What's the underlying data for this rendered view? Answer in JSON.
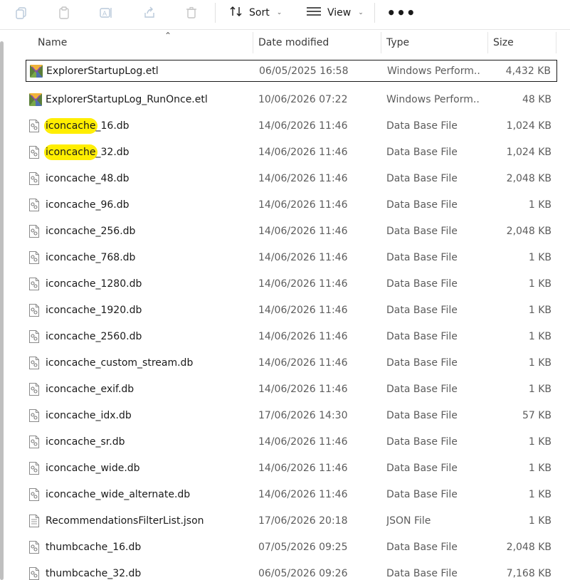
{
  "toolbar": {
    "sort_label": "Sort",
    "view_label": "View",
    "more_label": "•••"
  },
  "columns": {
    "name": "Name",
    "date": "Date modified",
    "type": "Type",
    "size": "Size"
  },
  "colors": {
    "highlight": "#ffee00",
    "text": "#1a1a1a",
    "muted": "#5c5c5c"
  },
  "files": [
    {
      "name": "ExplorerStartupLog.etl",
      "date": "06/05/2025 16:58",
      "type": "Windows Perform...",
      "size": "4,432 KB",
      "icon": "etl-file-icon",
      "selected": true
    },
    {
      "name": "ExplorerStartupLog_RunOnce.etl",
      "date": "10/06/2026 07:22",
      "type": "Windows Perform...",
      "size": "48 KB",
      "icon": "etl-file-icon"
    },
    {
      "name_hl": "iconcache",
      "name_rest": "_16.db",
      "name": "iconcache_16.db",
      "date": "14/06/2026 11:46",
      "type": "Data Base File",
      "size": "1,024 KB",
      "icon": "db-file-icon",
      "highlight": true
    },
    {
      "name_hl": "iconcache",
      "name_rest": "_32.db",
      "name": "iconcache_32.db",
      "date": "14/06/2026 11:46",
      "type": "Data Base File",
      "size": "1,024 KB",
      "icon": "db-file-icon",
      "highlight": true
    },
    {
      "name": "iconcache_48.db",
      "date": "14/06/2026 11:46",
      "type": "Data Base File",
      "size": "2,048 KB",
      "icon": "db-file-icon"
    },
    {
      "name": "iconcache_96.db",
      "date": "14/06/2026 11:46",
      "type": "Data Base File",
      "size": "1 KB",
      "icon": "db-file-icon"
    },
    {
      "name": "iconcache_256.db",
      "date": "14/06/2026 11:46",
      "type": "Data Base File",
      "size": "2,048 KB",
      "icon": "db-file-icon"
    },
    {
      "name": "iconcache_768.db",
      "date": "14/06/2026 11:46",
      "type": "Data Base File",
      "size": "1 KB",
      "icon": "db-file-icon"
    },
    {
      "name": "iconcache_1280.db",
      "date": "14/06/2026 11:46",
      "type": "Data Base File",
      "size": "1 KB",
      "icon": "db-file-icon"
    },
    {
      "name": "iconcache_1920.db",
      "date": "14/06/2026 11:46",
      "type": "Data Base File",
      "size": "1 KB",
      "icon": "db-file-icon"
    },
    {
      "name": "iconcache_2560.db",
      "date": "14/06/2026 11:46",
      "type": "Data Base File",
      "size": "1 KB",
      "icon": "db-file-icon"
    },
    {
      "name": "iconcache_custom_stream.db",
      "date": "14/06/2026 11:46",
      "type": "Data Base File",
      "size": "1 KB",
      "icon": "db-file-icon"
    },
    {
      "name": "iconcache_exif.db",
      "date": "14/06/2026 11:46",
      "type": "Data Base File",
      "size": "1 KB",
      "icon": "db-file-icon"
    },
    {
      "name": "iconcache_idx.db",
      "date": "17/06/2026 14:30",
      "type": "Data Base File",
      "size": "57 KB",
      "icon": "db-file-icon"
    },
    {
      "name": "iconcache_sr.db",
      "date": "14/06/2026 11:46",
      "type": "Data Base File",
      "size": "1 KB",
      "icon": "db-file-icon"
    },
    {
      "name": "iconcache_wide.db",
      "date": "14/06/2026 11:46",
      "type": "Data Base File",
      "size": "1 KB",
      "icon": "db-file-icon"
    },
    {
      "name": "iconcache_wide_alternate.db",
      "date": "14/06/2026 11:46",
      "type": "Data Base File",
      "size": "1 KB",
      "icon": "db-file-icon"
    },
    {
      "name": "RecommendationsFilterList.json",
      "date": "17/06/2026 20:18",
      "type": "JSON File",
      "size": "1 KB",
      "icon": "json-file-icon"
    },
    {
      "name": "thumbcache_16.db",
      "date": "07/05/2026 09:25",
      "type": "Data Base File",
      "size": "2,048 KB",
      "icon": "db-file-icon"
    },
    {
      "name": "thumbcache_32.db",
      "date": "06/05/2026 09:26",
      "type": "Data Base File",
      "size": "7,168 KB",
      "icon": "db-file-icon"
    }
  ]
}
